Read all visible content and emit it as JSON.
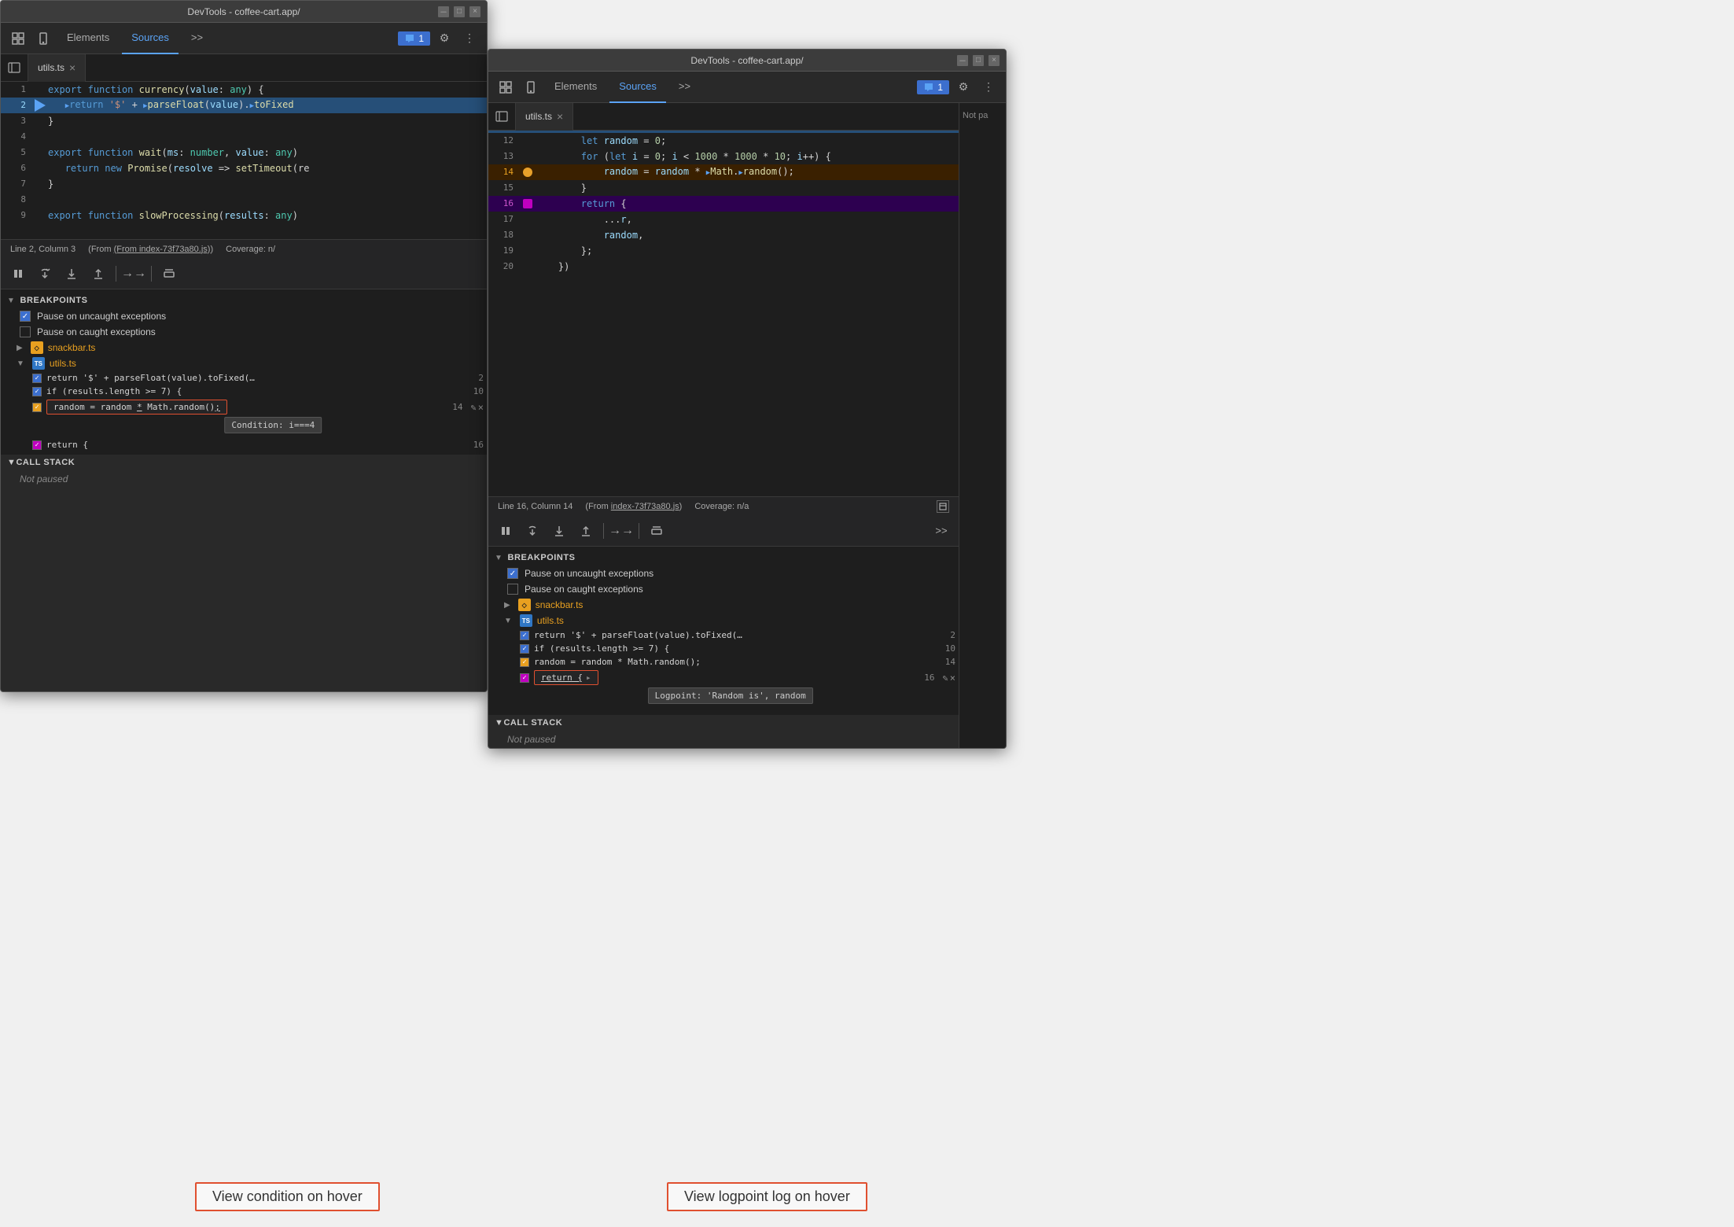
{
  "window1": {
    "title": "DevTools - coffee-cart.app/",
    "tabs": {
      "elements": "Elements",
      "sources": "Sources",
      "more": ">>"
    },
    "active_tab": "Sources",
    "chat_badge": "1",
    "file_tab": "utils.ts",
    "code_lines": [
      {
        "num": 1,
        "content": "export function currency(value: any) {",
        "type": "normal"
      },
      {
        "num": 2,
        "content": "   ▶return '$' + ▶parseFloat(value).▶toFixed",
        "type": "highlighted",
        "has_arrow": true
      },
      {
        "num": 3,
        "content": "}",
        "type": "normal"
      },
      {
        "num": 4,
        "content": "",
        "type": "normal"
      },
      {
        "num": 5,
        "content": "export function wait(ms: number, value: any)",
        "type": "normal"
      },
      {
        "num": 6,
        "content": "   return new Promise(resolve => setTimeout(re",
        "type": "normal"
      },
      {
        "num": 7,
        "content": "}",
        "type": "normal"
      },
      {
        "num": 8,
        "content": "",
        "type": "normal"
      },
      {
        "num": 9,
        "content": "export function slowProcessing(results: any)",
        "type": "normal"
      }
    ],
    "status_bar": {
      "line_col": "Line 2, Column 3",
      "from_file": "(From index-73f73a80.js)",
      "coverage": "Coverage: n/"
    },
    "debug_btns": [
      "⏸",
      "↺",
      "↓",
      "↑",
      "→→",
      "⛔"
    ],
    "breakpoints": {
      "label": "Breakpoints",
      "pause_uncaught": "Pause on uncaught exceptions",
      "pause_caught": "Pause on caught exceptions",
      "files": [
        {
          "name": "snackbar.ts",
          "expanded": false,
          "items": []
        },
        {
          "name": "utils.ts",
          "expanded": true,
          "items": [
            {
              "code": "return '$' + parseFloat(value).toFixed(…",
              "line": 2,
              "type": "normal"
            },
            {
              "code": "if (results.length >= 7) {",
              "line": 10,
              "type": "normal"
            },
            {
              "code": "random = random * Math.random();",
              "line": 14,
              "type": "conditional",
              "condition": "Condition: i===4",
              "has_condition_box": true
            },
            {
              "code": "return {",
              "line": 16,
              "type": "logpoint"
            }
          ]
        }
      ]
    },
    "callstack": {
      "label": "Call Stack",
      "status": "Not paused"
    }
  },
  "window2": {
    "title": "DevTools - coffee-cart.app/",
    "tabs": {
      "elements": "Elements",
      "sources": "Sources",
      "more": ">>"
    },
    "active_tab": "Sources",
    "chat_badge": "1",
    "file_tab": "utils.ts",
    "code_lines": [
      {
        "num": 12,
        "content": "        let random = 0;",
        "type": "normal"
      },
      {
        "num": 13,
        "content": "        for (let i = 0; i < 1000 * 1000 * 10; i++) {",
        "type": "normal"
      },
      {
        "num": 14,
        "content": "            random = random * ▶Math.▶random();",
        "type": "conditional"
      },
      {
        "num": 15,
        "content": "        }",
        "type": "normal"
      },
      {
        "num": 16,
        "content": "        return {",
        "type": "logpoint"
      },
      {
        "num": 17,
        "content": "            ...r,",
        "type": "normal"
      },
      {
        "num": 18,
        "content": "            random,",
        "type": "normal"
      },
      {
        "num": 19,
        "content": "        };",
        "type": "normal"
      },
      {
        "num": 20,
        "content": "    })",
        "type": "normal"
      }
    ],
    "status_bar": {
      "line_col": "Line 16, Column 14",
      "from_file": "(From index-73f73a80.js)",
      "coverage": "Coverage: n/a"
    },
    "debug_btns": [
      "⏸",
      "↺",
      "↓",
      "↑",
      "→→",
      "⛔"
    ],
    "breakpoints": {
      "label": "Breakpoints",
      "pause_uncaught": "Pause on uncaught exceptions",
      "pause_caught": "Pause on caught exceptions",
      "files": [
        {
          "name": "snackbar.ts",
          "expanded": false,
          "items": []
        },
        {
          "name": "utils.ts",
          "expanded": true,
          "items": [
            {
              "code": "return '$' + parseFloat(value).toFixed(…",
              "line": 2,
              "type": "normal"
            },
            {
              "code": "if (results.length >= 7) {",
              "line": 10,
              "type": "normal"
            },
            {
              "code": "random = random * Math.random();",
              "line": 14,
              "type": "conditional"
            },
            {
              "code": "return {",
              "line": 16,
              "type": "logpoint",
              "has_logpoint_box": true,
              "logpoint": "Logpoint: 'Random is', random"
            }
          ]
        }
      ]
    },
    "callstack": {
      "label": "Call Stack",
      "status": "Not paused"
    },
    "not_paused_right": "Not pa"
  },
  "annotations": {
    "view_condition": "View condition on hover",
    "view_logpoint": "View logpoint log on hover"
  },
  "icons": {
    "inspect": "⬚",
    "device": "📱",
    "dots": "⋮",
    "chevron_down": "▼",
    "chevron_right": "▶",
    "gear": "⚙",
    "chat": "💬",
    "sidebar": "◧",
    "pause": "⏸",
    "step_over": "↷",
    "step_into": "↓",
    "step_out": "↑",
    "continue": "⇒",
    "deactivate": "⊘",
    "pencil": "✎",
    "close_x": "×"
  }
}
